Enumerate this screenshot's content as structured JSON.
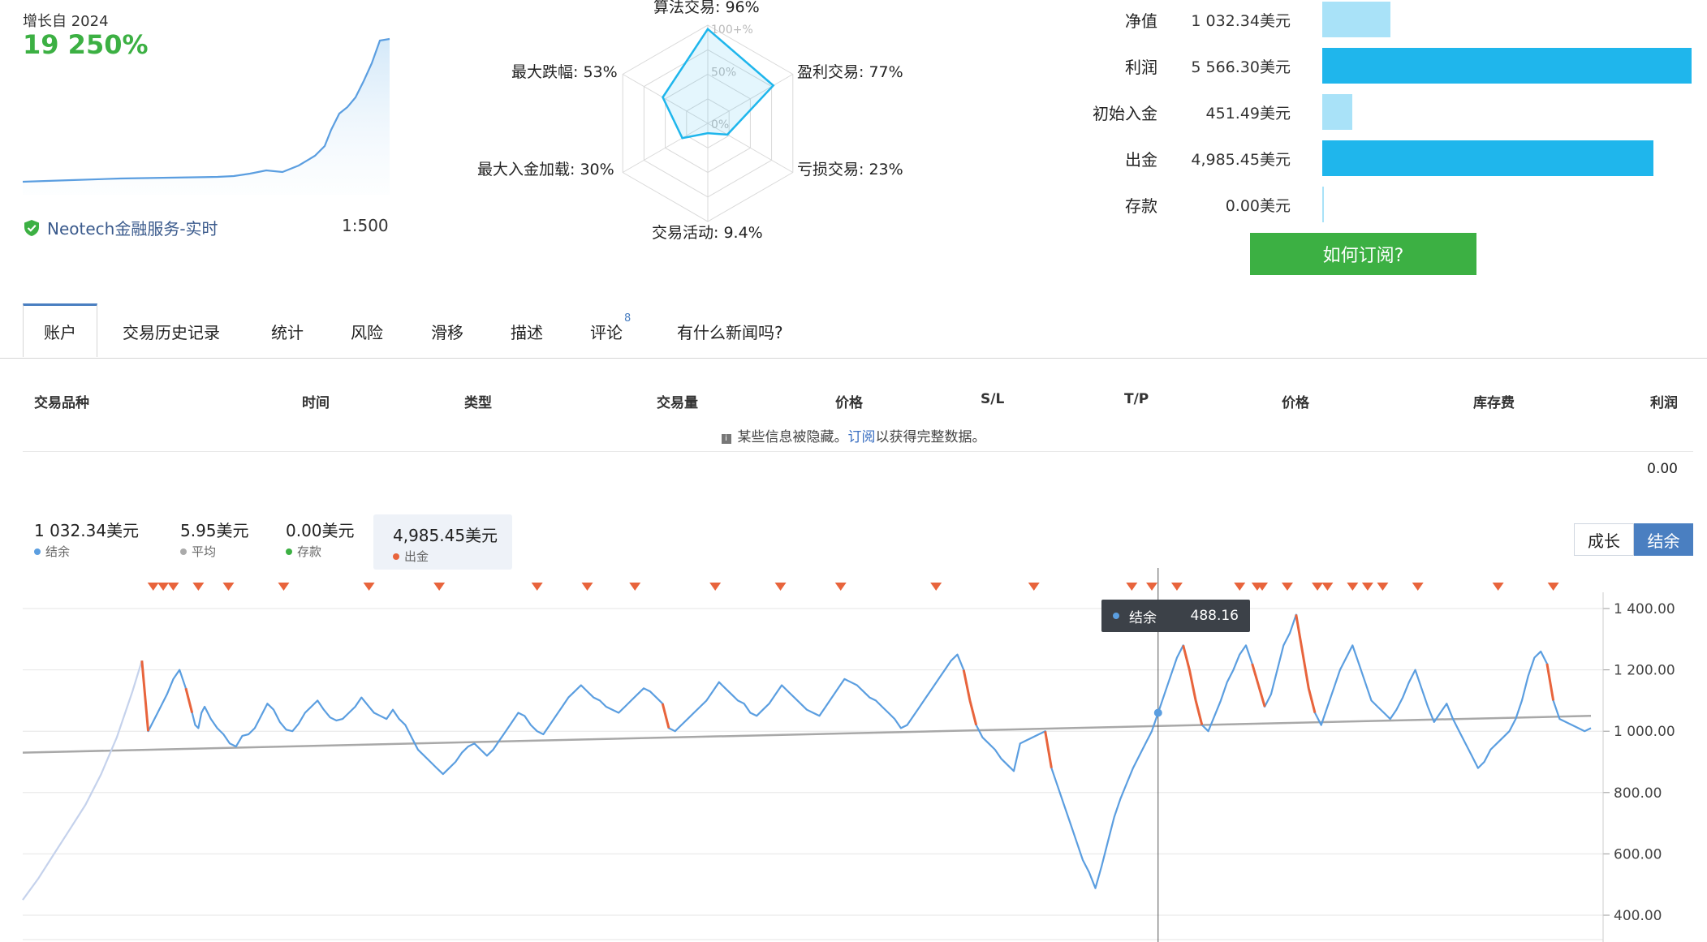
{
  "growth": {
    "label": "增长自 2024",
    "value": "19 250%"
  },
  "broker": {
    "name": "Neotech金融服务-实时",
    "leverage": "1:500"
  },
  "radar": {
    "ring_labels": [
      "100+%",
      "50%",
      "0%"
    ],
    "axes": [
      {
        "label": "算法交易: 96%",
        "value": 96
      },
      {
        "label": "盈利交易: 77%",
        "value": 77
      },
      {
        "label": "亏损交易: 23%",
        "value": 23
      },
      {
        "label": "交易活动: 9.4%",
        "value": 9.4
      },
      {
        "label": "最大入金加载: 30%",
        "value": 30
      },
      {
        "label": "最大跌幅: 53%",
        "value": 53
      }
    ]
  },
  "summary": {
    "rows": [
      {
        "label": "净值",
        "value": "1 032.34美元",
        "amount": 1032.34,
        "color": "#a9e2f8"
      },
      {
        "label": "利润",
        "value": "5 566.30美元",
        "amount": 5566.3,
        "color": "#1fb6ec"
      },
      {
        "label": "初始入金",
        "value": "451.49美元",
        "amount": 451.49,
        "color": "#a9e2f8"
      },
      {
        "label": "出金",
        "value": "4,985.45美元",
        "amount": 4985.45,
        "color": "#1fb6ec"
      },
      {
        "label": "存款",
        "value": "0.00美元",
        "amount": 0,
        "color": "#a9e2f8"
      }
    ],
    "subscribe": "如何订阅?"
  },
  "tabs": [
    {
      "label": "账户",
      "active": true
    },
    {
      "label": "交易历史记录"
    },
    {
      "label": "统计"
    },
    {
      "label": "风险"
    },
    {
      "label": "滑移"
    },
    {
      "label": "描述"
    },
    {
      "label": "评论",
      "badge": "8"
    },
    {
      "label": "有什么新闻吗?"
    }
  ],
  "table": {
    "headers": [
      "交易品种",
      "时间",
      "类型",
      "交易量",
      "价格",
      "S/L",
      "T/P",
      "价格",
      "库存费",
      "利润"
    ],
    "hidden_note_prefix": "某些信息被隐藏。",
    "hidden_note_link": "订阅",
    "hidden_note_suffix": "以获得完整数据。",
    "total": "0.00"
  },
  "stats": [
    {
      "value": "1 032.34美元",
      "label": "结余",
      "color": "#5b9ee0"
    },
    {
      "value": "5.95美元",
      "label": "平均",
      "color": "#aaaaaa"
    },
    {
      "value": "0.00美元",
      "label": "存款",
      "color": "#3cb043"
    },
    {
      "value": "4,985.45美元",
      "label": "出金",
      "color": "#e8643c",
      "selected": true
    }
  ],
  "toggles": {
    "growth": "成长",
    "balance": "结余"
  },
  "tooltip": {
    "label": "结余",
    "value": "488.16"
  },
  "chart_data": {
    "type": "line",
    "y_ticks": [
      "1 400.00",
      "1 200.00",
      "1 000.00",
      "800.00",
      "600.00",
      "400.00"
    ],
    "ylim": [
      380,
      1470
    ],
    "series": [
      {
        "name": "结余",
        "color": "#5b9ee0"
      },
      {
        "name": "平均",
        "color": "#aaaaaa"
      },
      {
        "name": "出金",
        "color": "#e8643c"
      }
    ],
    "balance_x": [
      0,
      5,
      10,
      15,
      20,
      25,
      30,
      35,
      38,
      40,
      43,
      46,
      48,
      50,
      52,
      54,
      55,
      56,
      57,
      58,
      60,
      62,
      64,
      66,
      68,
      70,
      72,
      74,
      76,
      78,
      80,
      82,
      84,
      86,
      88,
      90,
      92,
      94,
      96,
      98,
      100,
      102,
      104,
      106,
      108,
      110,
      112,
      114,
      116,
      118,
      120,
      122,
      124,
      126,
      128,
      130,
      132,
      134,
      136,
      138,
      140,
      142,
      144,
      146,
      148,
      150,
      152,
      154,
      156,
      158,
      160,
      162,
      164,
      166,
      168,
      170,
      172,
      174,
      176,
      178,
      180,
      182,
      184,
      186,
      188,
      190,
      192,
      194,
      196,
      198,
      200,
      202,
      204,
      206,
      208,
      210,
      212,
      214,
      216,
      218,
      220,
      222,
      224,
      226,
      228,
      230,
      232,
      234,
      236,
      238,
      240,
      242,
      244,
      246,
      248,
      250,
      252,
      254,
      256,
      258,
      260,
      262,
      264,
      266,
      268,
      270,
      272,
      274,
      276,
      278,
      280,
      282,
      284,
      286,
      288,
      290,
      292,
      294,
      296,
      298,
      300,
      302,
      304,
      306,
      308,
      310,
      312,
      314,
      316,
      318,
      320,
      322,
      324,
      326,
      328,
      330,
      332,
      334,
      336,
      338,
      340,
      342,
      344,
      346,
      348,
      350,
      352,
      354,
      356,
      358,
      360,
      362,
      364,
      366,
      368,
      370,
      372,
      374,
      376,
      378,
      380,
      382,
      384,
      386,
      388,
      390,
      392,
      394,
      396,
      398,
      400,
      402,
      404,
      406,
      408,
      410,
      412,
      414,
      416,
      418,
      420,
      422,
      424,
      426,
      428,
      430,
      432,
      434,
      436,
      438,
      440,
      442,
      444,
      446,
      448,
      450,
      452,
      454,
      456,
      458,
      460,
      462,
      464,
      466,
      468,
      470,
      472,
      474,
      476,
      478,
      480,
      482,
      484,
      486,
      488,
      490,
      492,
      494,
      496,
      498,
      500
    ],
    "balance": [
      450,
      520,
      600,
      680,
      760,
      860,
      980,
      1130,
      1230,
      1000,
      1060,
      1120,
      1170,
      1200,
      1140,
      1060,
      1020,
      1010,
      1060,
      1080,
      1040,
      1010,
      990,
      960,
      950,
      985,
      990,
      1010,
      1050,
      1090,
      1070,
      1030,
      1005,
      1000,
      1025,
      1060,
      1080,
      1100,
      1070,
      1045,
      1035,
      1040,
      1060,
      1080,
      1110,
      1085,
      1060,
      1050,
      1040,
      1070,
      1040,
      1020,
      980,
      940,
      920,
      900,
      880,
      860,
      880,
      900,
      930,
      950,
      960,
      940,
      920,
      940,
      970,
      1000,
      1030,
      1060,
      1050,
      1020,
      1000,
      990,
      1020,
      1050,
      1080,
      1110,
      1130,
      1150,
      1130,
      1110,
      1100,
      1080,
      1070,
      1060,
      1080,
      1100,
      1120,
      1140,
      1130,
      1110,
      1090,
      1010,
      1000,
      1020,
      1040,
      1060,
      1080,
      1100,
      1130,
      1160,
      1140,
      1120,
      1100,
      1090,
      1060,
      1050,
      1070,
      1090,
      1120,
      1150,
      1130,
      1110,
      1090,
      1070,
      1060,
      1050,
      1080,
      1110,
      1140,
      1170,
      1160,
      1150,
      1130,
      1110,
      1100,
      1080,
      1060,
      1040,
      1010,
      1020,
      1050,
      1080,
      1110,
      1140,
      1170,
      1200,
      1230,
      1250,
      1200,
      1100,
      1020,
      980,
      960,
      940,
      910,
      890,
      870,
      960,
      970,
      980,
      990,
      1000,
      880,
      820,
      760,
      700,
      640,
      580,
      540,
      488,
      560,
      640,
      720,
      780,
      830,
      880,
      920,
      960,
      1000,
      1060,
      1120,
      1180,
      1240,
      1280,
      1200,
      1100,
      1020,
      1000,
      1050,
      1100,
      1160,
      1200,
      1250,
      1280,
      1220,
      1150,
      1080,
      1120,
      1200,
      1280,
      1320,
      1380,
      1260,
      1140,
      1060,
      1020,
      1080,
      1140,
      1200,
      1240,
      1280,
      1220,
      1160,
      1100,
      1080,
      1060,
      1040,
      1070,
      1110,
      1160,
      1200,
      1140,
      1080,
      1030,
      1060,
      1090,
      1040,
      1000,
      960,
      920,
      880,
      900,
      940,
      960,
      980,
      1000,
      1040,
      1100,
      1180,
      1240,
      1260,
      1220,
      1100,
      1040,
      1030,
      1020,
      1010,
      1000,
      1010,
      1020,
      1030
    ],
    "average_start": 930,
    "average_end": 1050,
    "withdrawal_markers_x": [
      52,
      56,
      60,
      70,
      82,
      104,
      138,
      166,
      205,
      225,
      244,
      276,
      302,
      326,
      364,
      403,
      442,
      450,
      460,
      485,
      492,
      494,
      504,
      516,
      520,
      530,
      536,
      542,
      556,
      588,
      610
    ],
    "withdrawal_marker_scale": 625,
    "hover_index": 171
  }
}
